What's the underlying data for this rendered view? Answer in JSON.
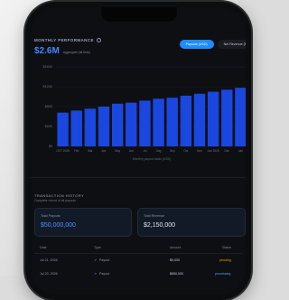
{
  "performance": {
    "title": "MONTHLY PERFORMANCE",
    "total": "$2.6M",
    "total_caption": "aggregate (all time)",
    "toggle_active": "Payouts (USD)",
    "toggle_inactive": "Net Revenue (M)"
  },
  "chart_data": {
    "type": "bar",
    "categories": [
      "OCT 2025",
      "Feb",
      "Mar",
      "Apr",
      "May",
      "Jun",
      "Jul",
      "Aug",
      "Sep",
      "Oct",
      "Nov",
      "Jan 2026",
      "Dec",
      "Jan"
    ],
    "values": [
      68,
      72,
      76,
      80,
      86,
      88,
      92,
      96,
      98,
      102,
      106,
      110,
      114,
      118
    ],
    "ylabel": "",
    "xlabel": "",
    "y_ticks": [
      "$0",
      "$40K",
      "$80K",
      "$120K",
      "$160K"
    ],
    "ylim": [
      0,
      160
    ],
    "caption": "Monthly payout totals (USD)",
    "grid": true,
    "bar_color": "#1a47e0"
  },
  "transactions": {
    "title": "TRANSACTION HISTORY",
    "subtitle": "Complete record of all payouts",
    "card_left_label": "Total Payouts",
    "card_left_value": "$50,000,000",
    "card_right_label": "Total Revenue",
    "card_right_value": "$2,150,000",
    "columns": [
      "Date",
      "Type",
      "Amount",
      "Status"
    ],
    "rows": [
      {
        "date": "Jul 21, 2026",
        "type": "Payout",
        "amount": "$9,000",
        "status": "pending"
      },
      {
        "date": "Jul 20, 2026",
        "type": "Payout",
        "amount": "$650,000",
        "status": "processing"
      }
    ]
  }
}
